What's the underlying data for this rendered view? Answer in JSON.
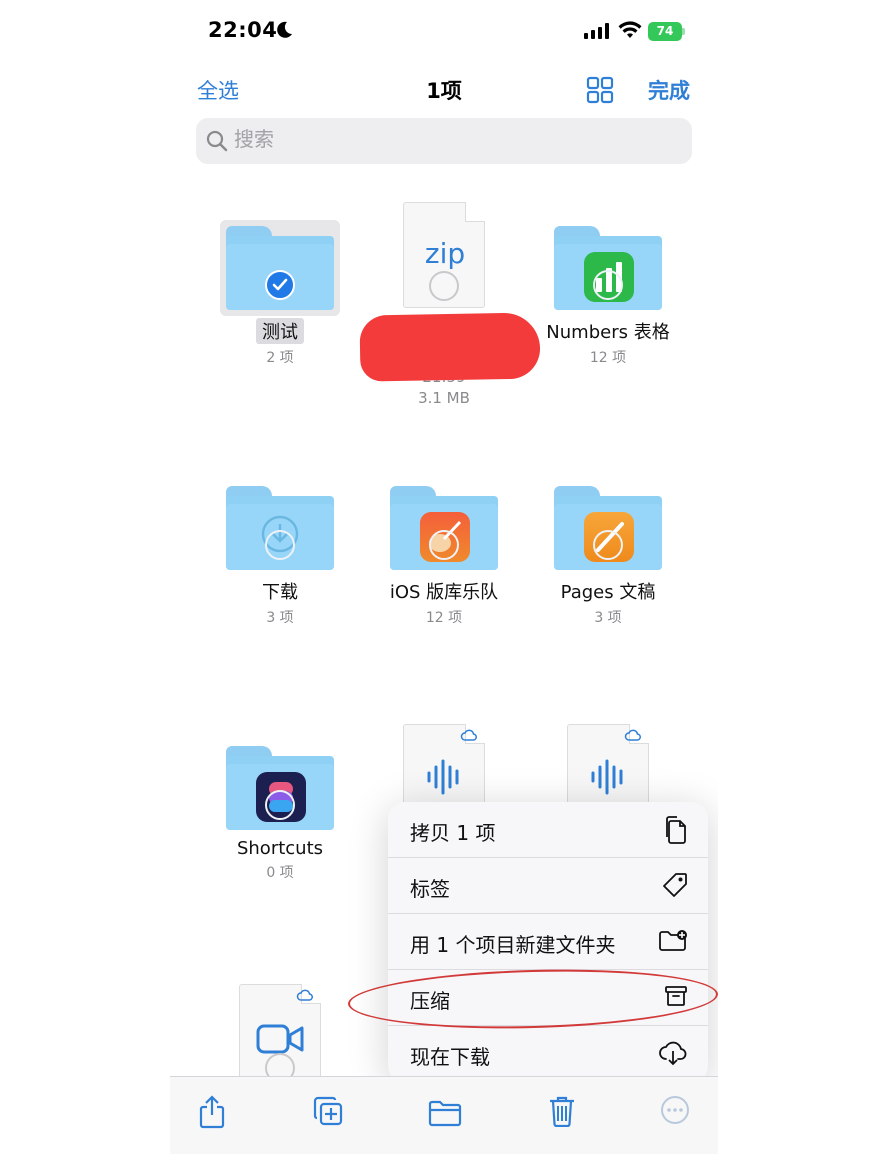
{
  "status_bar": {
    "time": "22:04",
    "battery": "74"
  },
  "nav": {
    "select_all": "全选",
    "title": "1项",
    "done": "完成"
  },
  "search": {
    "placeholder": "搜索"
  },
  "items": [
    {
      "name": "测试",
      "meta": "2 项"
    },
    {
      "name": "",
      "meta": "21:59",
      "size": "3.1 MB",
      "badge": "zip"
    },
    {
      "name": "Numbers 表格",
      "meta": "12 项"
    },
    {
      "name": "下载",
      "meta": "3 项"
    },
    {
      "name": "iOS 版库乐队",
      "meta": "12 项"
    },
    {
      "name": "Pages 文稿",
      "meta": "3 项"
    },
    {
      "name": "Shortcuts",
      "meta": "0 项"
    }
  ],
  "menu": [
    {
      "label": "拷贝 1 项",
      "icon": "copy-icon"
    },
    {
      "label": "标签",
      "icon": "tag-icon"
    },
    {
      "label": "用 1 个项目新建文件夹",
      "icon": "new-folder-icon"
    },
    {
      "label": "压缩",
      "icon": "archive-icon"
    },
    {
      "label": "现在下载",
      "icon": "cloud-download-icon"
    }
  ],
  "toolbar": [
    "share-icon",
    "duplicate-icon",
    "folder-icon",
    "trash-icon",
    "more-icon"
  ],
  "colors": {
    "accent": "#2f7fd6",
    "folder": "#97d6f8",
    "battery": "#34c759",
    "redaction": "#f33b3b"
  }
}
